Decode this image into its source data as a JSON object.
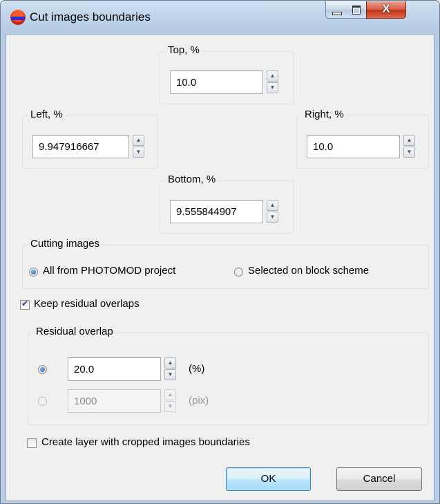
{
  "window": {
    "title": "Cut images boundaries",
    "minimize_label": "",
    "maximize_label": "",
    "close_label": "X"
  },
  "boundaries": {
    "top": {
      "title": "Top, %",
      "value": "10.0"
    },
    "left": {
      "title": "Left, %",
      "value": "9.947916667"
    },
    "right": {
      "title": "Right, %",
      "value": "10.0"
    },
    "bottom": {
      "title": "Bottom, %",
      "value": "9.555844907"
    }
  },
  "cutting": {
    "title": "Cutting images",
    "options": [
      {
        "label": "All from PHOTOMOD project",
        "selected": true
      },
      {
        "label": "Selected on block scheme",
        "selected": false
      }
    ]
  },
  "keep_residual": {
    "label": "Keep residual overlaps",
    "checked": true
  },
  "residual": {
    "title": "Residual overlap",
    "percent": {
      "value": "20.0",
      "unit": "(%)",
      "selected": true
    },
    "pixels": {
      "value": "1000",
      "unit": "(pix)",
      "selected": false,
      "disabled": true
    }
  },
  "create_layer": {
    "label": "Create layer with cropped images boundaries",
    "checked": false
  },
  "buttons": {
    "ok": "OK",
    "cancel": "Cancel"
  },
  "icons": {
    "app": "photomod-app-icon",
    "up": "spin-up-icon",
    "down": "spin-down-icon"
  }
}
